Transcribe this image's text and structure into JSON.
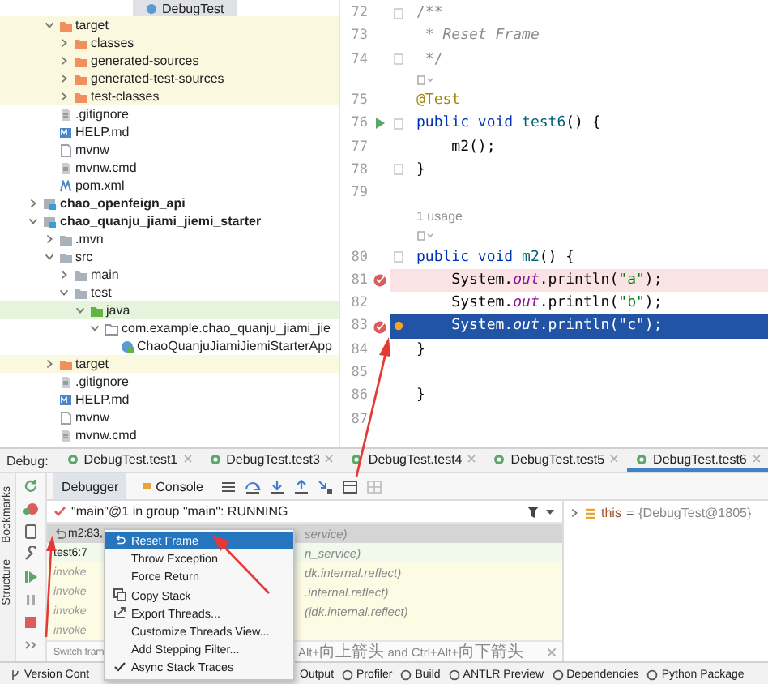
{
  "project_tree": {
    "tab": "DebugTest",
    "items": [
      {
        "children": [
          {
            "label": "target",
            "kind": "excluded",
            "expanded": true,
            "children": [
              {
                "label": "classes",
                "kind": "excluded",
                "expanded": false
              },
              {
                "label": "generated-sources",
                "kind": "excluded",
                "expanded": false
              },
              {
                "label": "generated-test-sources",
                "kind": "excluded",
                "expanded": false
              },
              {
                "label": "test-classes",
                "kind": "excluded",
                "expanded": false
              }
            ]
          },
          {
            "label": ".gitignore",
            "kind": "text"
          },
          {
            "label": "HELP.md",
            "kind": "markdown"
          },
          {
            "label": "mvnw",
            "kind": "file"
          },
          {
            "label": "mvnw.cmd",
            "kind": "text"
          },
          {
            "label": "pom.xml",
            "kind": "maven"
          }
        ]
      },
      {
        "label": "chao_openfeign_api",
        "kind": "module",
        "expanded": false
      },
      {
        "label": "chao_quanju_jiami_jiemi_starter",
        "kind": "module",
        "expanded": true,
        "children": [
          {
            "label": ".mvn",
            "kind": "folder",
            "expanded": false
          },
          {
            "label": "src",
            "kind": "folder",
            "expanded": true,
            "children": [
              {
                "label": "main",
                "kind": "folder",
                "expanded": false
              },
              {
                "label": "test",
                "kind": "folder",
                "expanded": true,
                "children": [
                  {
                    "label": "java",
                    "kind": "tests",
                    "expanded": true,
                    "children": [
                      {
                        "label": "com.example.chao_quanju_jiami_jie",
                        "kind": "package",
                        "expanded": true,
                        "children": [
                          {
                            "label": "ChaoQuanjuJiamiJiemiStarterApp",
                            "kind": "class"
                          }
                        ]
                      }
                    ]
                  }
                ]
              }
            ]
          },
          {
            "label": "target",
            "kind": "excluded",
            "expanded": false
          },
          {
            "label": ".gitignore",
            "kind": "text"
          },
          {
            "label": "HELP.md",
            "kind": "markdown"
          },
          {
            "label": "mvnw",
            "kind": "file"
          },
          {
            "label": "mvnw.cmd",
            "kind": "text"
          }
        ]
      }
    ]
  },
  "editor": {
    "lines": [
      {
        "kind": "code",
        "number": "72",
        "fold": true,
        "runnable": false,
        "breakpoint": false,
        "current": false,
        "tokens": [
          {
            "kind": "comment",
            "text": "/**"
          }
        ]
      },
      {
        "kind": "code",
        "number": "73",
        "fold": false,
        "runnable": false,
        "breakpoint": false,
        "current": false,
        "tokens": [
          {
            "kind": "doc",
            "text": " * Reset Frame"
          }
        ]
      },
      {
        "kind": "code",
        "number": "74",
        "fold": true,
        "runnable": false,
        "breakpoint": false,
        "current": false,
        "tokens": [
          {
            "kind": "comment",
            "text": " */"
          }
        ]
      },
      {
        "kind": "inlay"
      },
      {
        "kind": "code",
        "number": "75",
        "fold": false,
        "runnable": false,
        "breakpoint": false,
        "current": false,
        "tokens": [
          {
            "kind": "annotation",
            "text": "@Test"
          }
        ]
      },
      {
        "kind": "code",
        "number": "76",
        "fold": true,
        "runnable": true,
        "breakpoint": false,
        "current": false,
        "tokens": [
          {
            "kind": "keyword",
            "text": "public void "
          },
          {
            "kind": "method",
            "text": "test6"
          },
          {
            "kind": "plain",
            "text": "() {"
          }
        ]
      },
      {
        "kind": "code",
        "number": "77",
        "fold": false,
        "runnable": false,
        "breakpoint": false,
        "current": false,
        "tokens": [
          {
            "kind": "plain",
            "text": "    m2();"
          }
        ]
      },
      {
        "kind": "code",
        "number": "78",
        "fold": true,
        "runnable": false,
        "breakpoint": false,
        "current": false,
        "tokens": [
          {
            "kind": "plain",
            "text": "}"
          }
        ]
      },
      {
        "kind": "code",
        "number": "79",
        "fold": false,
        "runnable": false,
        "breakpoint": false,
        "current": false
      },
      {
        "kind": "usage",
        "text": "1 usage"
      },
      {
        "kind": "inlay"
      },
      {
        "kind": "code",
        "number": "80",
        "fold": true,
        "runnable": false,
        "breakpoint": false,
        "current": false,
        "tokens": [
          {
            "kind": "keyword",
            "text": "public void "
          },
          {
            "kind": "method",
            "text": "m2"
          },
          {
            "kind": "plain",
            "text": "() {"
          }
        ]
      },
      {
        "kind": "code",
        "number": "81",
        "fold": false,
        "runnable": false,
        "breakpoint": true,
        "current": false,
        "tokens": [
          {
            "kind": "plain",
            "text": "    System."
          },
          {
            "kind": "field",
            "text": "out"
          },
          {
            "kind": "plain",
            "text": ".println("
          },
          {
            "kind": "string",
            "text": "\"a\""
          },
          {
            "kind": "plain",
            "text": ");"
          }
        ]
      },
      {
        "kind": "code",
        "number": "82",
        "fold": false,
        "runnable": false,
        "breakpoint": false,
        "current": false,
        "tokens": [
          {
            "kind": "plain",
            "text": "    System."
          },
          {
            "kind": "field",
            "text": "out"
          },
          {
            "kind": "plain",
            "text": ".println("
          },
          {
            "kind": "string",
            "text": "\"b\""
          },
          {
            "kind": "plain",
            "text": ");"
          }
        ]
      },
      {
        "kind": "code",
        "number": "83",
        "fold": false,
        "runnable": false,
        "breakpoint": true,
        "current": true,
        "tokens": [
          {
            "kind": "plain",
            "text": "    System."
          },
          {
            "kind": "field",
            "text": "out"
          },
          {
            "kind": "plain",
            "text": ".println("
          },
          {
            "kind": "string",
            "text": "\"c\""
          },
          {
            "kind": "plain",
            "text": ");"
          }
        ]
      },
      {
        "kind": "code",
        "number": "84",
        "fold": false,
        "runnable": false,
        "breakpoint": false,
        "current": false,
        "tokens": [
          {
            "kind": "plain",
            "text": "}"
          }
        ]
      },
      {
        "kind": "code",
        "number": "85",
        "fold": false,
        "runnable": false,
        "breakpoint": false,
        "current": false
      },
      {
        "kind": "code",
        "number": "86",
        "fold": false,
        "runnable": false,
        "breakpoint": false,
        "current": false,
        "tokens": [
          {
            "kind": "plain",
            "text": "}"
          }
        ]
      },
      {
        "kind": "code",
        "number": "87",
        "fold": false,
        "runnable": false,
        "breakpoint": false,
        "current": false
      }
    ]
  },
  "debug": {
    "label": "Debug:",
    "sessions": [
      {
        "label": "DebugTest.test1",
        "selected": false
      },
      {
        "label": "DebugTest.test3",
        "selected": false
      },
      {
        "label": "DebugTest.test4",
        "selected": false
      },
      {
        "label": "DebugTest.test5",
        "selected": false
      },
      {
        "label": "DebugTest.test6",
        "selected": true
      }
    ],
    "tabs": [
      {
        "label": "Debugger",
        "selected": true
      },
      {
        "label": "Console",
        "selected": false
      }
    ],
    "side_tabs": [
      "Bookmarks",
      "Structure"
    ],
    "thread": "\"main\"@1 in group \"main\": RUNNING",
    "frames": [
      {
        "method": "m2:83,",
        "detail": "service)",
        "kind": "app",
        "selected": true
      },
      {
        "method": "test6:7",
        "detail": "n_service)",
        "kind": "app",
        "selected": false
      },
      {
        "method": "invoke",
        "detail": "dk.internal.reflect)",
        "kind": "library",
        "selected": false
      },
      {
        "method": "invoke",
        "detail": ".internal.reflect)",
        "kind": "library",
        "selected": false
      },
      {
        "method": "invoke",
        "detail": "(jdk.internal.reflect)",
        "kind": "library",
        "selected": false
      },
      {
        "method": "invoke",
        "kind": "library",
        "selected": false
      }
    ],
    "hint": {
      "start": "Switch fram",
      "end": "Alt+向上箭头 and Ctrl+Alt+向下箭头"
    },
    "variables": [
      {
        "name": "this",
        "separator": "=",
        "value": "{DebugTest@1805}",
        "expanded": false
      }
    ]
  },
  "context_menu": {
    "items": [
      {
        "label": "Reset Frame",
        "selected": true,
        "checked": false
      },
      {
        "label": "Throw Exception",
        "selected": false,
        "checked": false
      },
      {
        "label": "Force Return",
        "selected": false,
        "checked": false
      },
      {
        "label": "Copy Stack",
        "selected": false,
        "checked": false
      },
      {
        "label": "Export Threads...",
        "selected": false,
        "checked": false
      },
      {
        "label": "Customize Threads View...",
        "selected": false,
        "checked": false
      },
      {
        "label": "Add Stepping Filter...",
        "selected": false,
        "checked": false
      },
      {
        "label": "Async Stack Traces",
        "selected": false,
        "checked": true
      }
    ]
  },
  "status_bar": [
    "Version Cont",
    "Output",
    "Profiler",
    "Build",
    "ANTLR Preview",
    "Dependencies",
    "Python Package"
  ]
}
